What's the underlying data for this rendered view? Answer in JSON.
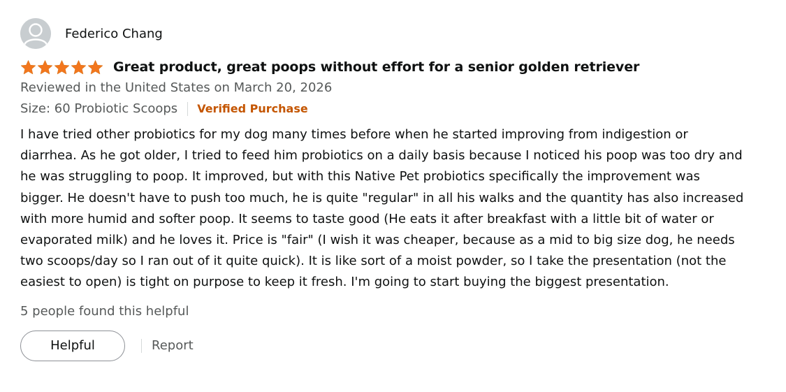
{
  "review": {
    "profile_name": "Federico Chang",
    "rating": 5,
    "rating_max": 5,
    "star_color": "#f3761d",
    "title": "Great product, great poops without effort for a senior golden retriever",
    "date_text": "Reviewed in the United States on March 20, 2026",
    "size_text": "Size: 60 Probiotic Scoops",
    "verified_text": "Verified Purchase",
    "body": "I have tried other probiotics for my dog many times before when he started improving from indigestion or diarrhea. As he got older, I tried to feed him probiotics on a daily basis because I noticed his poop was too dry and he was struggling to poop. It improved, but with this Native Pet probiotics specifically the improvement was bigger. He doesn't have to push too much, he is quite \"regular\" in all his walks and the quantity has also increased with more humid and softer poop. It seems to taste good (He eats it after breakfast with a little bit of water or evaporated milk) and he loves it. Price is \"fair\" (I wish it was cheaper, because as a mid to big size dog, he needs two scoops/day so I ran out of it quite quick). It is like sort of a moist powder, so I take the presentation (not the easiest to open) is tight on purpose to keep it fresh. I'm going to start buying the biggest presentation.",
    "helpful_count_text": "5 people found this helpful",
    "helpful_button_label": "Helpful",
    "report_label": "Report"
  }
}
